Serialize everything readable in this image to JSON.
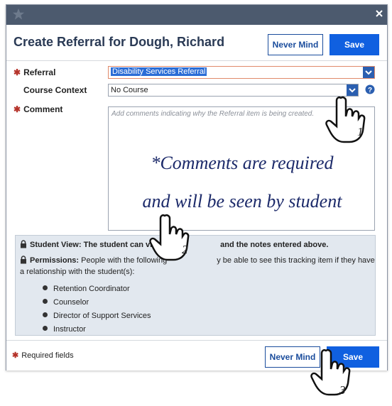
{
  "dialog": {
    "title": "Create Referral for Dough, Richard",
    "never_mind_label": "Never Mind",
    "save_label": "Save"
  },
  "form": {
    "referral": {
      "label": "Referral",
      "value": "Disability Services Referral"
    },
    "course_context": {
      "label": "Course Context",
      "value": "No Course"
    },
    "comment": {
      "label": "Comment",
      "placeholder": "Add comments indicating why the Referral item is being created.",
      "overlay_line1": "*Comments are required",
      "overlay_line2": "and will be seen by student"
    }
  },
  "info": {
    "student_view": {
      "title": "Student View:",
      "text": "The student can vi",
      "text_tail": "and the notes entered above."
    },
    "permissions": {
      "title": "Permissions:",
      "text_line1a": "People with the following",
      "text_line1b": "y be able to see this tracking item if they have",
      "text_line2": "a relationship with the student(s):"
    },
    "roles": [
      "Retention Coordinator",
      "Counselor",
      "Director of Support Services",
      "Instructor"
    ]
  },
  "footer": {
    "required_note": "Required fields",
    "never_mind_label": "Never Mind",
    "save_label": "Save"
  },
  "annotations": [
    "1",
    "2",
    "3"
  ],
  "colors": {
    "titlebar": "#4c5a6e",
    "primary": "#1060e0",
    "required": "#b5332a",
    "overlay_text": "#1c2a6a"
  }
}
